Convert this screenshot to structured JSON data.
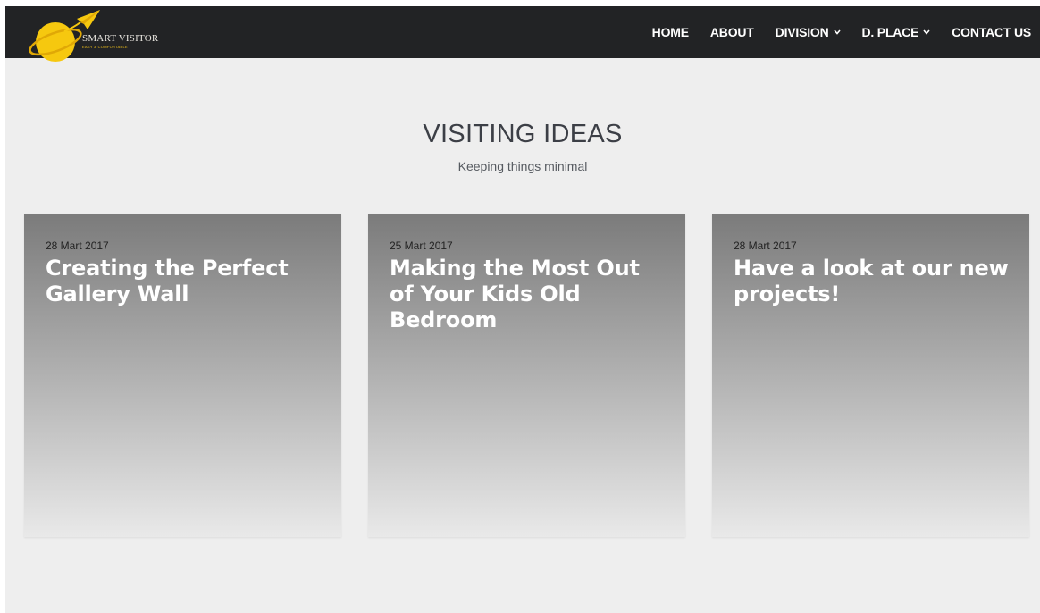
{
  "header": {
    "logo": {
      "title": "SMART VISITOR",
      "tagline": "EASY & COMFORTABLE",
      "icon": "planet-plane-icon",
      "colors": {
        "planet": "#f6c80f",
        "text": "#e9e6e0"
      }
    },
    "nav": [
      {
        "label": "HOME",
        "dropdown": false
      },
      {
        "label": "ABOUT",
        "dropdown": false
      },
      {
        "label": "DIVISION",
        "dropdown": true
      },
      {
        "label": "D. PLACE",
        "dropdown": true
      },
      {
        "label": "CONTACT US",
        "dropdown": false
      }
    ],
    "colors": {
      "background": "#222325",
      "link": "#ffffff"
    }
  },
  "section": {
    "title": "VISITING IDEAS",
    "subtitle": "Keeping things minimal"
  },
  "cards": [
    {
      "date": "28 Mart 2017",
      "title": "Creating the Perfect Gallery Wall"
    },
    {
      "date": "25 Mart 2017",
      "title": "Making the Most Out of Your Kids Old Bedroom"
    },
    {
      "date": "28 Mart 2017",
      "title": "Have a look at our new projects!"
    }
  ],
  "colors": {
    "page_background": "#eeeeee",
    "heading": "#3c3f46",
    "card_gradient_top": "#7b7b7b",
    "card_gradient_bottom": "#e9e9e9"
  }
}
